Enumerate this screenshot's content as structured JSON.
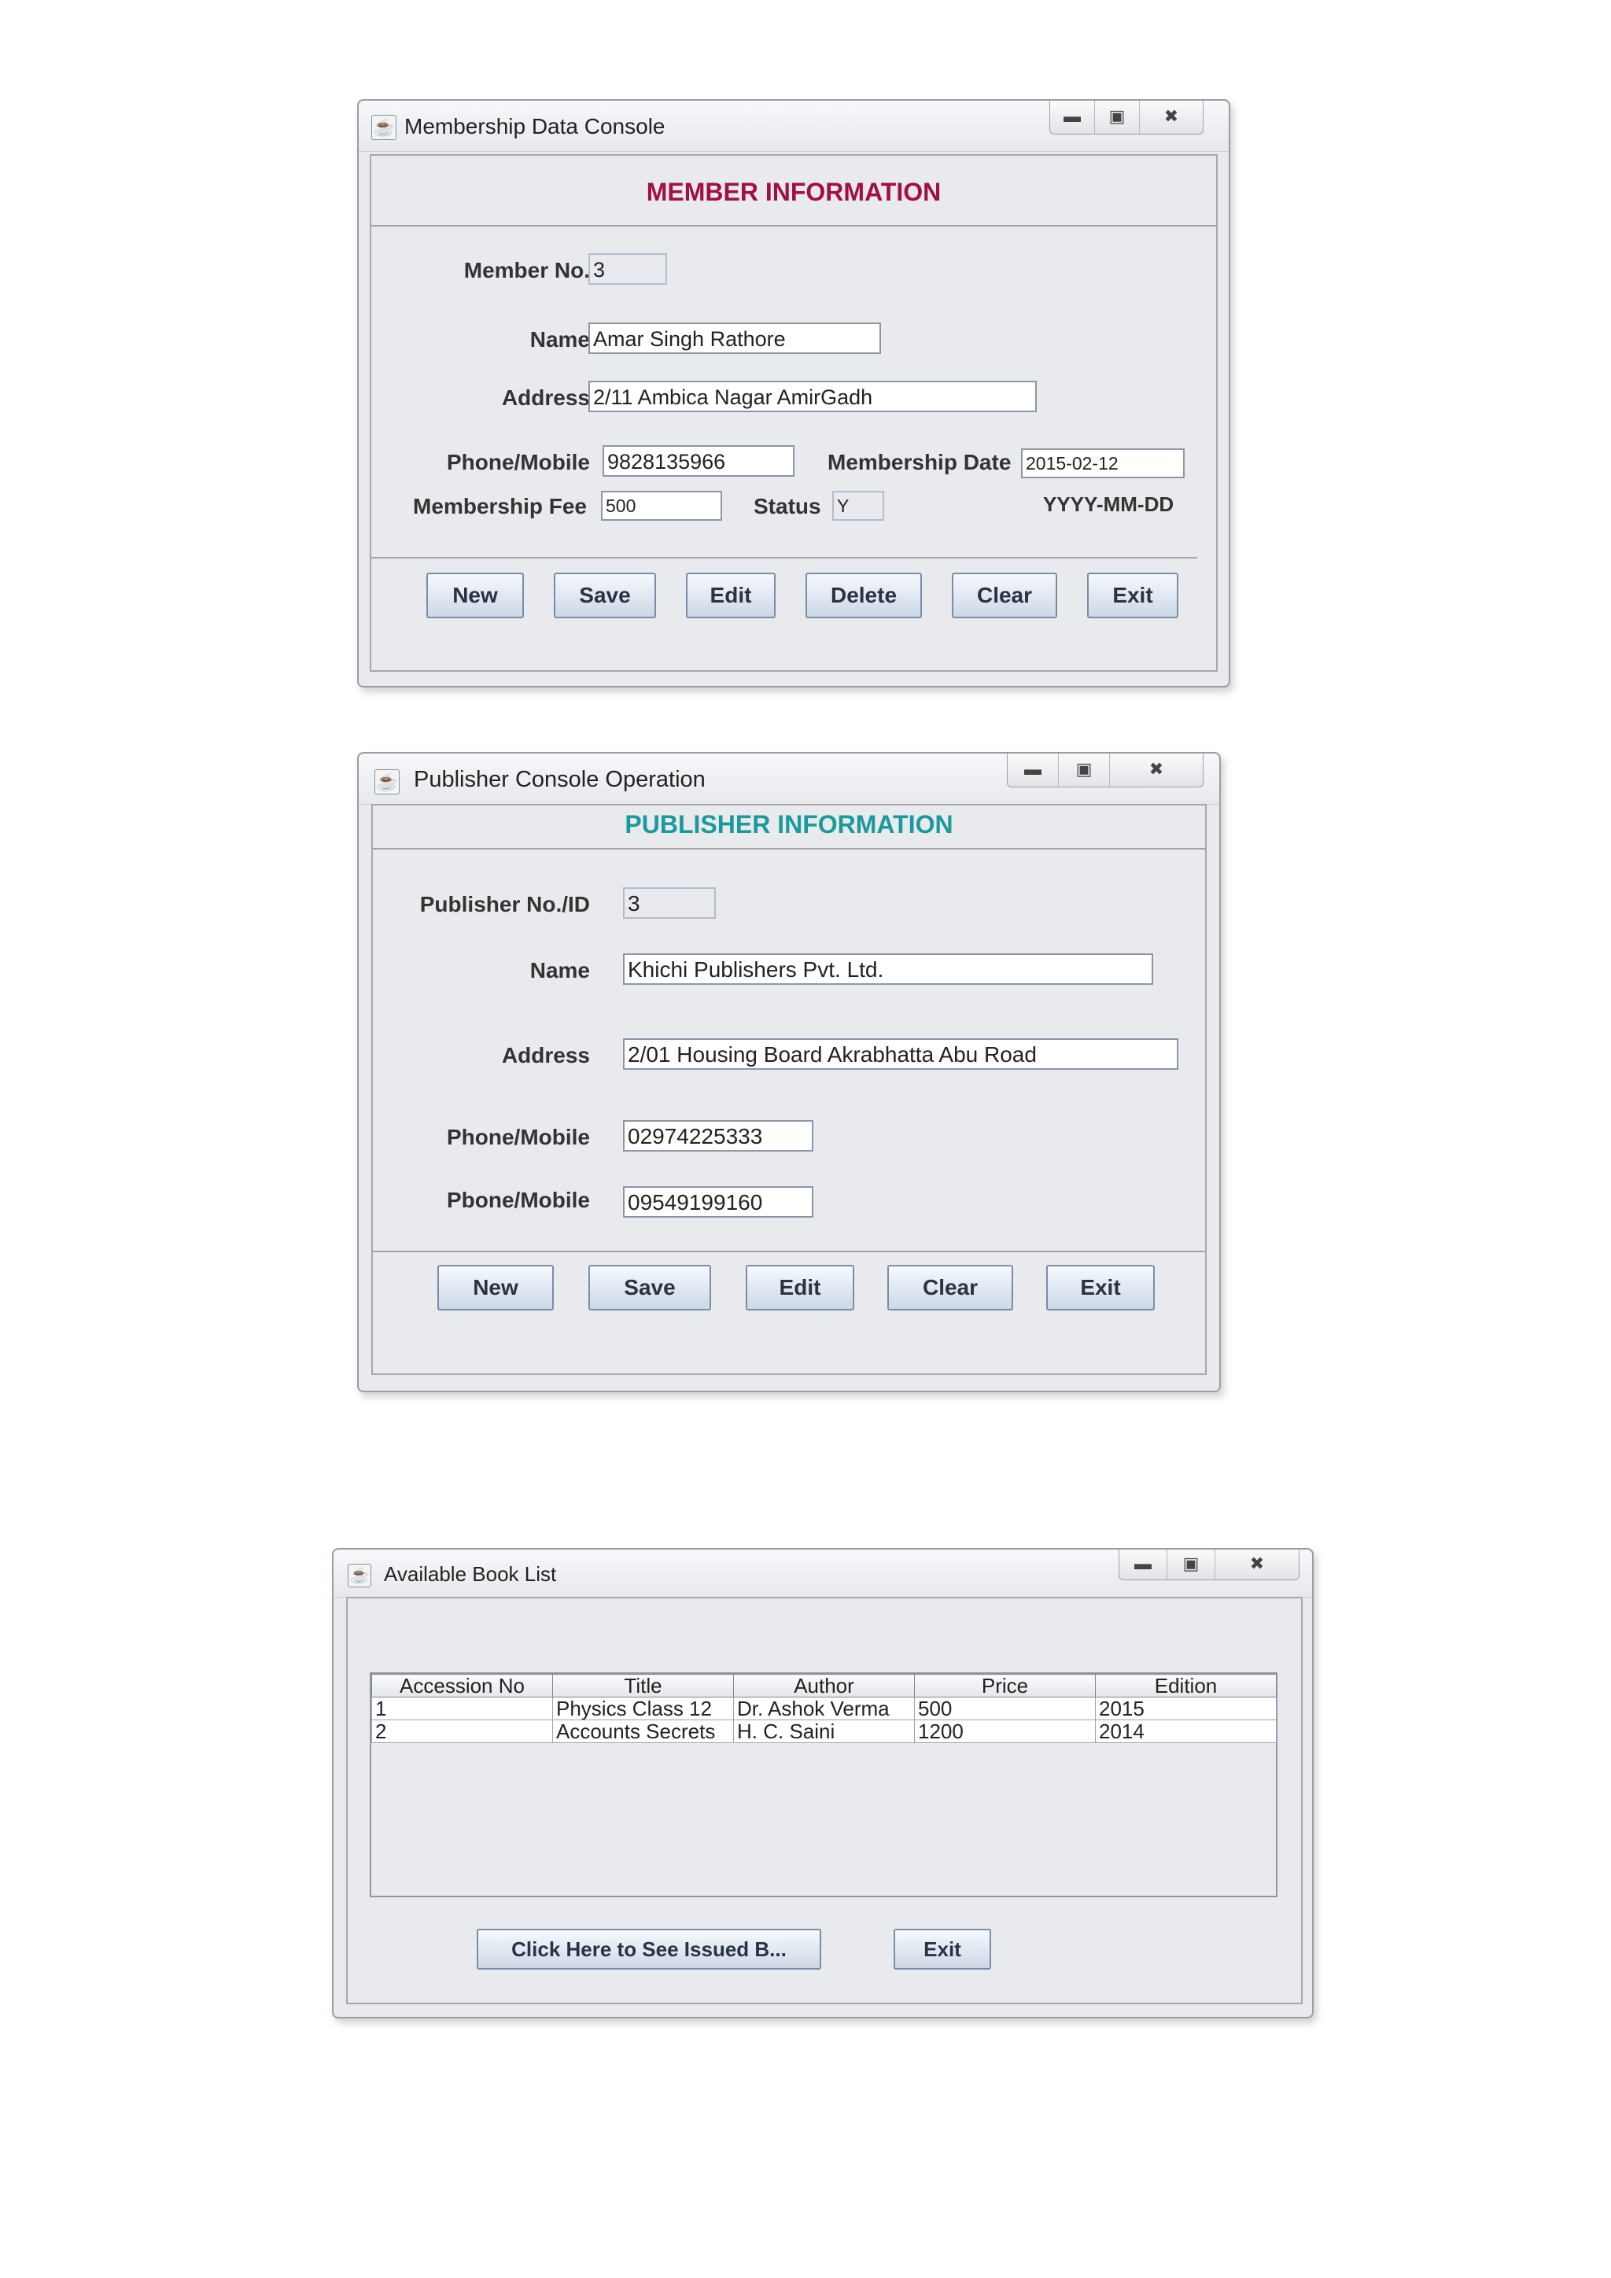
{
  "member_window": {
    "title": "Membership Data Console",
    "heading": "MEMBER INFORMATION",
    "heading_color": "#a01040",
    "fields": {
      "member_no": {
        "label": "Member No.",
        "value": "3"
      },
      "name": {
        "label": "Name",
        "value": "Amar Singh Rathore"
      },
      "address": {
        "label": "Address",
        "value": "2/11 Ambica Nagar AmirGadh"
      },
      "phone": {
        "label": "Phone/Mobile",
        "value": "9828135966"
      },
      "membership_date": {
        "label": "Membership Date",
        "value": "2015-02-12"
      },
      "date_format": "YYYY-MM-DD",
      "membership_fee": {
        "label": "Membership Fee",
        "value": "500"
      },
      "status": {
        "label": "Status",
        "value": "Y"
      }
    },
    "buttons": {
      "new": "New",
      "save": "Save",
      "edit": "Edit",
      "delete": "Delete",
      "clear": "Clear",
      "exit": "Exit"
    }
  },
  "publisher_window": {
    "title": "Publisher Console Operation",
    "heading": "PUBLISHER INFORMATION",
    "heading_color": "#1a9a9a",
    "fields": {
      "publisher_no": {
        "label": "Publisher No./ID",
        "value": "3"
      },
      "name": {
        "label": "Name",
        "value": "Khichi Publishers Pvt. Ltd."
      },
      "address": {
        "label": "Address",
        "value": "2/01 Housing Board Akrabhatta Abu Road"
      },
      "phone1": {
        "label": "Phone/Mobile",
        "value": "02974225333"
      },
      "phone2": {
        "label": "Pbone/Mobile",
        "value": "09549199160"
      }
    },
    "buttons": {
      "new": "New",
      "save": "Save",
      "edit": "Edit",
      "clear": "Clear",
      "exit": "Exit"
    }
  },
  "books_window": {
    "title": "Available Book List",
    "columns": [
      "Accession No",
      "Title",
      "Author",
      "Price",
      "Edition"
    ],
    "rows": [
      [
        "1",
        "Physics Class 12",
        "Dr. Ashok Verma",
        "500",
        "2015"
      ],
      [
        "2",
        "Accounts Secrets",
        "H. C. Saini",
        "1200",
        "2014"
      ]
    ],
    "buttons": {
      "issued": "Click Here to See Issued B...",
      "exit": "Exit"
    }
  },
  "window_controls": {
    "minimize_icon": "minimize-icon",
    "maximize_icon": "maximize-icon",
    "close_icon": "close-icon"
  }
}
